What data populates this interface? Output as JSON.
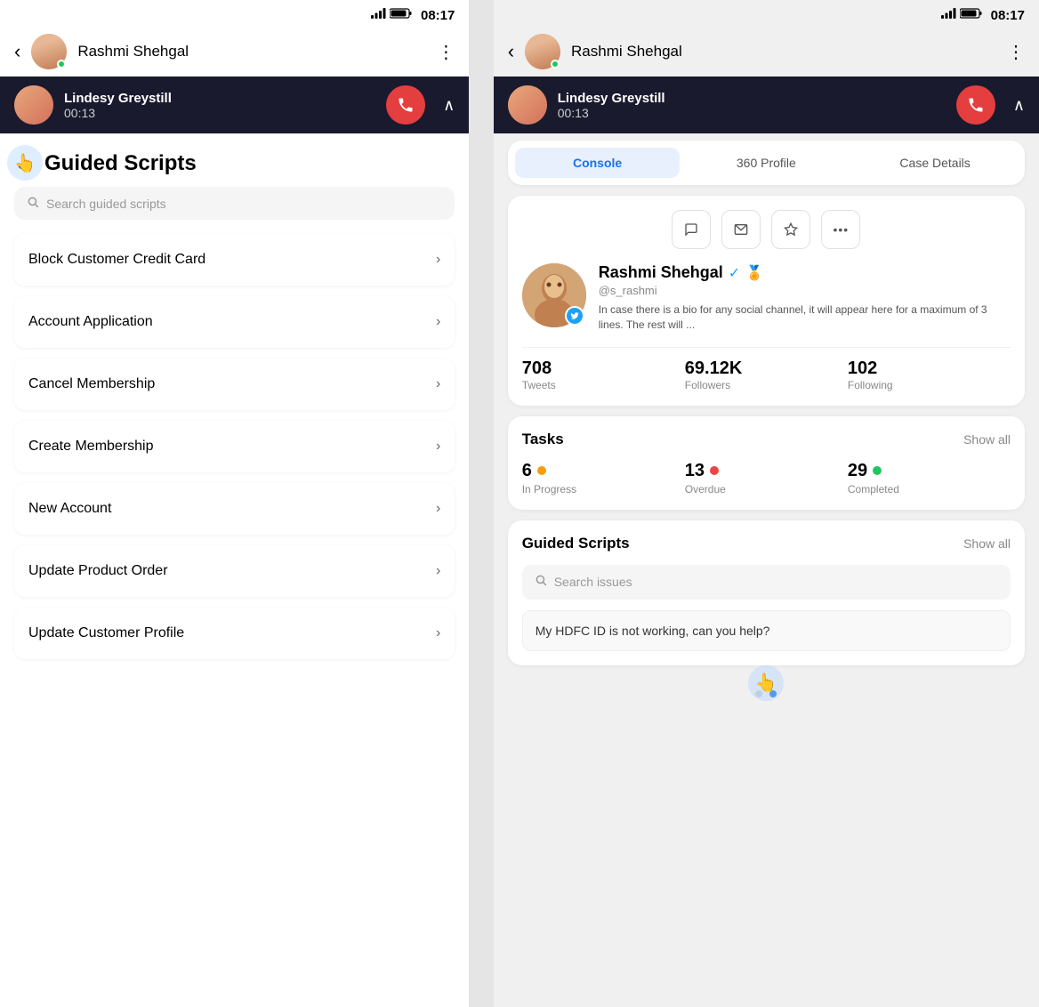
{
  "left_screen": {
    "status_bar": {
      "time": "08:17",
      "signal": "📶",
      "battery": "🔋"
    },
    "top_nav": {
      "back_label": "‹",
      "contact_name": "Rashmi Shehgal",
      "more_icon": "⋮"
    },
    "call_banner": {
      "caller_name": "Lindesy Greystill",
      "call_time": "00:13",
      "end_call_icon": "📞",
      "expand_icon": "∧"
    },
    "page_title": "Guided Scripts",
    "back_icon": "←",
    "search_placeholder": "Search guided scripts",
    "script_items": [
      {
        "label": "Block Customer Credit Card"
      },
      {
        "label": "Account Application"
      },
      {
        "label": "Cancel Membership"
      },
      {
        "label": "Create Membership"
      },
      {
        "label": "New Account"
      },
      {
        "label": "Update Product Order"
      },
      {
        "label": "Update Customer Profile"
      }
    ],
    "chevron": "›"
  },
  "right_screen": {
    "status_bar": {
      "time": "08:17",
      "signal": "📶",
      "battery": "🔋"
    },
    "top_nav": {
      "back_label": "‹",
      "contact_name": "Rashmi Shehgal",
      "more_icon": "⋮"
    },
    "call_banner": {
      "caller_name": "Lindesy Greystill",
      "call_time": "00:13",
      "end_call_icon": "📞",
      "expand_icon": "∧"
    },
    "tabs": [
      {
        "label": "Console",
        "active": true
      },
      {
        "label": "360 Profile",
        "active": false
      },
      {
        "label": "Case Details",
        "active": false
      }
    ],
    "profile": {
      "name": "Rashmi Shehgal",
      "handle": "@s_rashmi",
      "bio": "In case there is a bio for any social channel, it will appear here for a maximum of 3 lines. The rest will ...",
      "verified": true,
      "stats": [
        {
          "number": "708",
          "label": "Tweets"
        },
        {
          "number": "69.12K",
          "label": "Followers"
        },
        {
          "number": "102",
          "label": "Following"
        }
      ],
      "action_icons": [
        {
          "icon": "💬",
          "name": "message-icon"
        },
        {
          "icon": "✉",
          "name": "email-icon"
        },
        {
          "icon": "📌",
          "name": "pin-icon"
        },
        {
          "icon": "•••",
          "name": "more-options-icon"
        }
      ]
    },
    "tasks": {
      "title": "Tasks",
      "show_all": "Show all",
      "items": [
        {
          "count": "6",
          "label": "In Progress",
          "dot_class": "dot-yellow"
        },
        {
          "count": "13",
          "label": "Overdue",
          "dot_class": "dot-red"
        },
        {
          "count": "29",
          "label": "Completed",
          "dot_class": "dot-green"
        }
      ]
    },
    "guided_scripts": {
      "title": "Guided Scripts",
      "show_all": "Show all",
      "search_placeholder": "Search issues",
      "suggestion": "My HDFC ID is not working, can you help?"
    },
    "dots": [
      {
        "active": false
      },
      {
        "active": true
      }
    ]
  }
}
